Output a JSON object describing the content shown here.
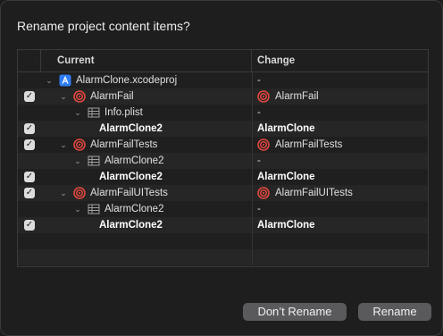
{
  "dialog": {
    "title": "Rename project content items?"
  },
  "table": {
    "columns": {
      "current": "Current",
      "change": "Change"
    },
    "rows": [
      {
        "current": "AlarmClone.xcodeproj",
        "change": "-"
      },
      {
        "current": "AlarmFail",
        "change": "AlarmFail"
      },
      {
        "current": "Info.plist",
        "change": "-"
      },
      {
        "current": "AlarmClone2",
        "change": "AlarmClone"
      },
      {
        "current": "AlarmFailTests",
        "change": "AlarmFailTests"
      },
      {
        "current": "AlarmClone2",
        "change": "-"
      },
      {
        "current": "AlarmClone2",
        "change": "AlarmClone"
      },
      {
        "current": "AlarmFailUITests",
        "change": "AlarmFailUITests"
      },
      {
        "current": "AlarmClone2",
        "change": "-"
      },
      {
        "current": "AlarmClone2",
        "change": "AlarmClone"
      }
    ]
  },
  "buttons": {
    "dont_rename": "Don’t Rename",
    "rename": "Rename"
  },
  "colors": {
    "target_icon": "#e0483e",
    "project_icon": "#2f7df6",
    "accent_gray": "#5a5a5c"
  },
  "checkmark": "✓"
}
